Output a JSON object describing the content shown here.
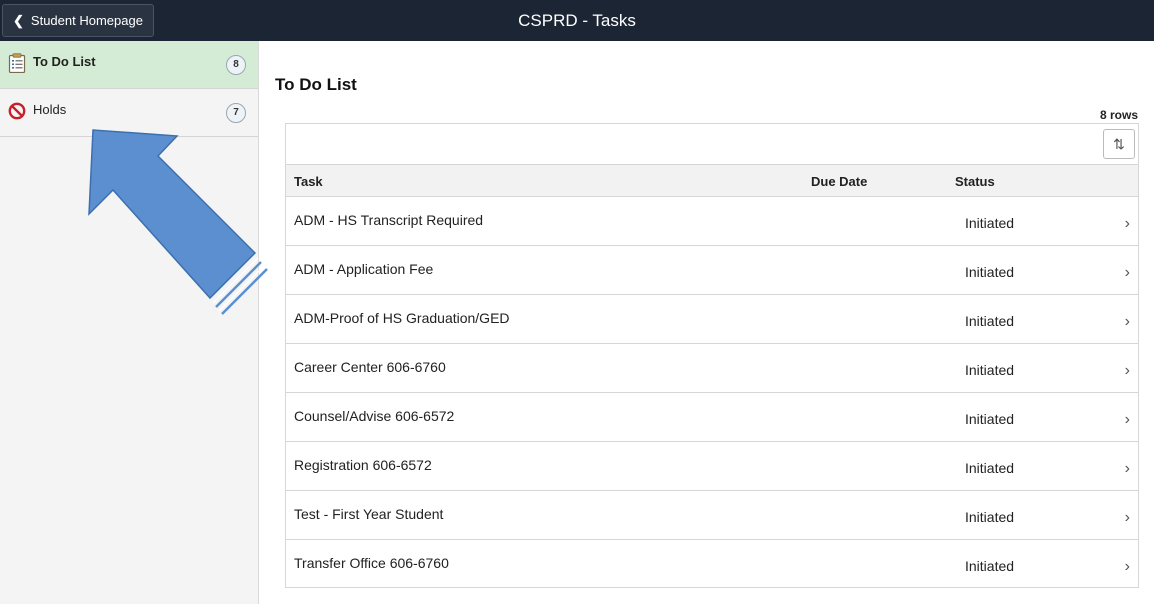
{
  "header": {
    "back_label": "Student Homepage",
    "title": "CSPRD - Tasks"
  },
  "sidebar": {
    "items": [
      {
        "label": "To Do List",
        "count": "8",
        "icon": "clipboard-icon",
        "active": true
      },
      {
        "label": "Holds",
        "count": "7",
        "icon": "no-entry-icon",
        "active": false
      }
    ]
  },
  "main": {
    "title": "To Do List",
    "row_count": "8 rows",
    "columns": {
      "task": "Task",
      "due_date": "Due Date",
      "status": "Status"
    },
    "rows": [
      {
        "task": "ADM - HS Transcript Required",
        "due_date": "",
        "status": "Initiated"
      },
      {
        "task": "ADM - Application Fee",
        "due_date": "",
        "status": "Initiated"
      },
      {
        "task": "ADM-Proof of HS Graduation/GED",
        "due_date": "",
        "status": "Initiated"
      },
      {
        "task": "Career Center 606-6760",
        "due_date": "",
        "status": "Initiated"
      },
      {
        "task": "Counsel/Advise 606-6572",
        "due_date": "",
        "status": "Initiated"
      },
      {
        "task": "Registration 606-6572",
        "due_date": "",
        "status": "Initiated"
      },
      {
        "task": "Test - First Year Student",
        "due_date": "",
        "status": "Initiated"
      },
      {
        "task": "Transfer Office 606-6760",
        "due_date": "",
        "status": "Initiated"
      }
    ]
  },
  "colors": {
    "header_bg": "#1c2533",
    "active_item_bg": "#d4ecd6",
    "annotation_arrow": "#5b8fd0"
  }
}
